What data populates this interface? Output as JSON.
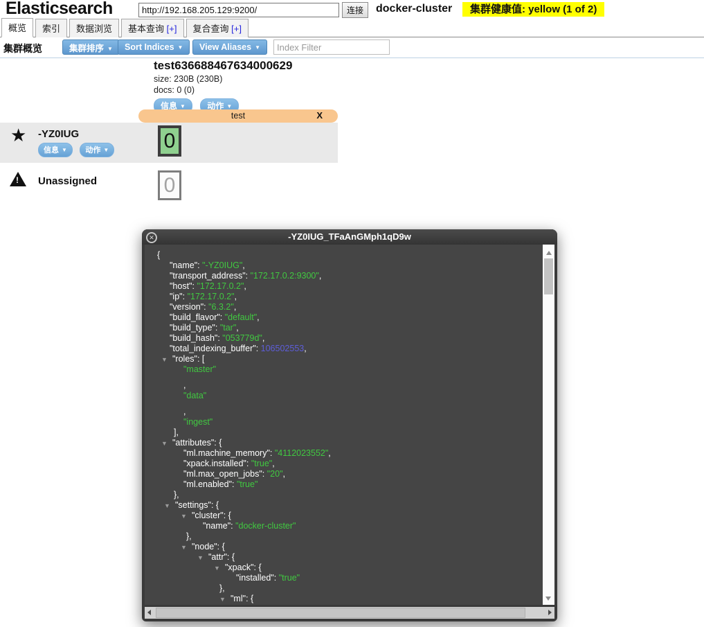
{
  "header": {
    "app_title": "Elasticsearch",
    "url_value": "http://192.168.205.129:9200/",
    "connect_label": "连接",
    "cluster_name": "docker-cluster",
    "health_label": "集群健康值: yellow (1 of 2)",
    "health_color": "#ffff00"
  },
  "tabs": {
    "items": [
      {
        "name": "tab-overview",
        "label": "概览",
        "active": true
      },
      {
        "name": "tab-indices",
        "label": "索引"
      },
      {
        "name": "tab-browser",
        "label": "数据浏览"
      },
      {
        "name": "tab-structured-query",
        "label": "基本查询",
        "plus": "[+]"
      },
      {
        "name": "tab-any-request",
        "label": "复合查询",
        "plus": "[+]"
      }
    ]
  },
  "toolbar": {
    "section_label": "集群概览",
    "buttons": [
      {
        "name": "sort-cluster-button",
        "label": "集群排序",
        "caret": "▼"
      },
      {
        "name": "sort-indices-button",
        "label": "Sort Indices",
        "caret": "▼"
      },
      {
        "name": "view-aliases-button",
        "label": "View Aliases",
        "caret": "▼"
      }
    ],
    "filter_placeholder": "Index Filter"
  },
  "index": {
    "name": "test636688467634000629",
    "size_line": "size: 230B (230B)",
    "docs_line": "docs: 0 (0)",
    "info_label": "信息",
    "actions_label": "动作",
    "caret": "▼",
    "alias_label": "test",
    "alias_close": "X"
  },
  "node_row": {
    "star_icon": "★",
    "name": "-YZ0IUG",
    "info_label": "信息",
    "actions_label": "动作",
    "caret": "▼",
    "shard_value": "0",
    "shard_color": "#8fd08f"
  },
  "unassigned_row": {
    "warning_icon": "!",
    "label": "Unassigned",
    "shard_value": "0"
  },
  "modal": {
    "title": "-YZ0IUG_TFaAnGMph1qD9w",
    "close_icon": "✕",
    "colors": {
      "string": "#41c941",
      "number": "#5d5dd8",
      "key": "#ffffff",
      "background": "#454545"
    },
    "json_lines": [
      {
        "ind": 18,
        "segs": [
          [
            "{",
            "p"
          ]
        ]
      },
      {
        "ind": 36,
        "segs": [
          [
            "\"name\": ",
            "k"
          ],
          [
            "\"-YZ0IUG\"",
            "s"
          ],
          [
            ",",
            "p"
          ]
        ]
      },
      {
        "ind": 36,
        "segs": [
          [
            "\"transport_address\": ",
            "k"
          ],
          [
            "\"172.17.0.2:9300\"",
            "s"
          ],
          [
            ",",
            "p"
          ]
        ]
      },
      {
        "ind": 36,
        "segs": [
          [
            "\"host\": ",
            "k"
          ],
          [
            "\"172.17.0.2\"",
            "s"
          ],
          [
            ",",
            "p"
          ]
        ]
      },
      {
        "ind": 36,
        "segs": [
          [
            "\"ip\": ",
            "k"
          ],
          [
            "\"172.17.0.2\"",
            "s"
          ],
          [
            ",",
            "p"
          ]
        ]
      },
      {
        "ind": 36,
        "segs": [
          [
            "\"version\": ",
            "k"
          ],
          [
            "\"6.3.2\"",
            "s"
          ],
          [
            ",",
            "p"
          ]
        ]
      },
      {
        "ind": 36,
        "segs": [
          [
            "\"build_flavor\": ",
            "k"
          ],
          [
            "\"default\"",
            "s"
          ],
          [
            ",",
            "p"
          ]
        ]
      },
      {
        "ind": 36,
        "segs": [
          [
            "\"build_type\": ",
            "k"
          ],
          [
            "\"tar\"",
            "s"
          ],
          [
            ",",
            "p"
          ]
        ]
      },
      {
        "ind": 36,
        "segs": [
          [
            "\"build_hash\": ",
            "k"
          ],
          [
            "\"053779d\"",
            "s"
          ],
          [
            ",",
            "p"
          ]
        ]
      },
      {
        "ind": 36,
        "segs": [
          [
            "\"total_indexing_buffer\": ",
            "k"
          ],
          [
            "106502553",
            "n"
          ],
          [
            ",",
            "p"
          ]
        ]
      },
      {
        "ind": 40,
        "arr": 24,
        "segs": [
          [
            "\"roles\": [",
            "k"
          ]
        ]
      },
      {
        "ind": 56,
        "segs": [
          [
            "\"master\"",
            "s"
          ]
        ]
      },
      {
        "ind": 56,
        "gap": 1,
        "segs": [
          [
            ",",
            "p"
          ]
        ]
      },
      {
        "ind": 56,
        "segs": [
          [
            "\"data\"",
            "s"
          ]
        ]
      },
      {
        "ind": 56,
        "gap": 1,
        "segs": [
          [
            ",",
            "p"
          ]
        ]
      },
      {
        "ind": 56,
        "segs": [
          [
            "\"ingest\"",
            "s"
          ]
        ]
      },
      {
        "ind": 42,
        "segs": [
          [
            "],",
            "p"
          ]
        ]
      },
      {
        "ind": 40,
        "arr": 24,
        "segs": [
          [
            "\"attributes\": {",
            "k"
          ]
        ]
      },
      {
        "ind": 56,
        "segs": [
          [
            "\"ml.machine_memory\": ",
            "k"
          ],
          [
            "\"4112023552\"",
            "s"
          ],
          [
            ",",
            "p"
          ]
        ]
      },
      {
        "ind": 56,
        "segs": [
          [
            "\"xpack.installed\": ",
            "k"
          ],
          [
            "\"true\"",
            "s"
          ],
          [
            ",",
            "p"
          ]
        ]
      },
      {
        "ind": 56,
        "segs": [
          [
            "\"ml.max_open_jobs\": ",
            "k"
          ],
          [
            "\"20\"",
            "s"
          ],
          [
            ",",
            "p"
          ]
        ]
      },
      {
        "ind": 56,
        "segs": [
          [
            "\"ml.enabled\": ",
            "k"
          ],
          [
            "\"true\"",
            "s"
          ]
        ]
      },
      {
        "ind": 42,
        "segs": [
          [
            "},",
            "p"
          ]
        ]
      },
      {
        "ind": 44,
        "arr": 28,
        "segs": [
          [
            "\"settings\": {",
            "k"
          ]
        ]
      },
      {
        "ind": 68,
        "arr": 52,
        "segs": [
          [
            "\"cluster\": {",
            "k"
          ]
        ]
      },
      {
        "ind": 84,
        "segs": [
          [
            "\"name\": ",
            "k"
          ],
          [
            "\"docker-cluster\"",
            "s"
          ]
        ]
      },
      {
        "ind": 60,
        "segs": [
          [
            "},",
            "p"
          ]
        ]
      },
      {
        "ind": 68,
        "arr": 52,
        "segs": [
          [
            "\"node\": {",
            "k"
          ]
        ]
      },
      {
        "ind": 92,
        "arr": 76,
        "segs": [
          [
            "\"attr\": {",
            "k"
          ]
        ]
      },
      {
        "ind": 116,
        "arr": 100,
        "segs": [
          [
            "\"xpack\": {",
            "k"
          ]
        ]
      },
      {
        "ind": 132,
        "segs": [
          [
            "\"installed\": ",
            "k"
          ],
          [
            "\"true\"",
            "s"
          ]
        ]
      },
      {
        "ind": 108,
        "segs": [
          [
            "},",
            "p"
          ]
        ]
      },
      {
        "ind": 124,
        "arr": 108,
        "segs": [
          [
            "\"ml\": {",
            "k"
          ]
        ]
      }
    ]
  }
}
